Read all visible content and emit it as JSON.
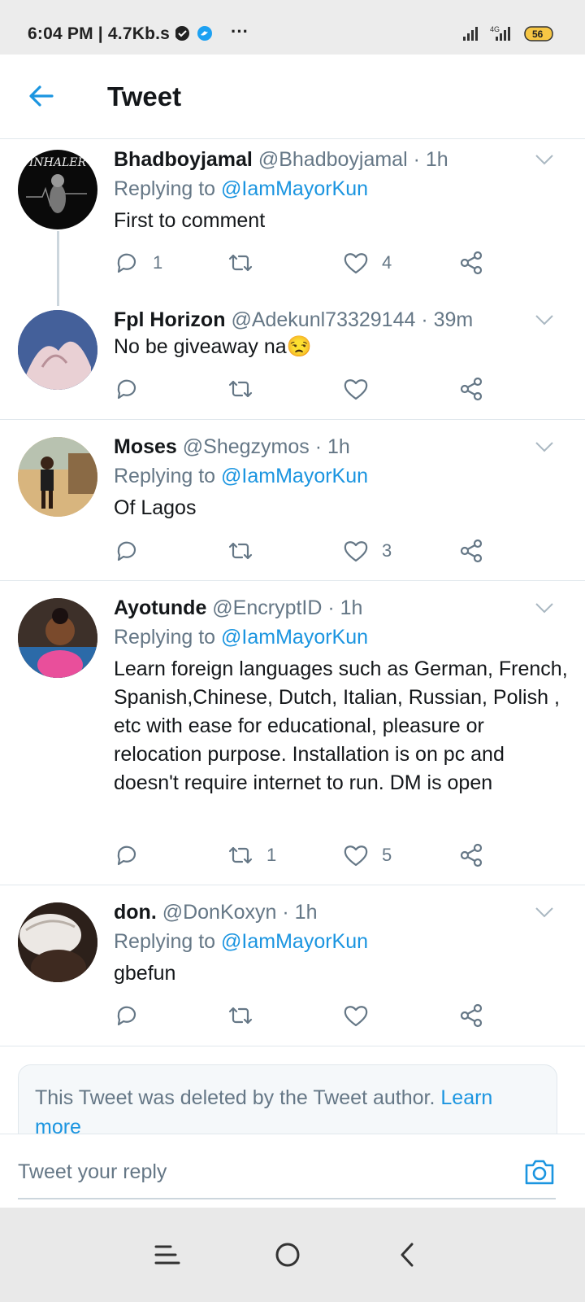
{
  "status_bar": {
    "time_speed": "6:04 PM | 4.7Kb.s",
    "more": "···",
    "network": "4G",
    "battery": "56"
  },
  "header": {
    "title": "Tweet"
  },
  "tweets": [
    {
      "name": "Bhadboyjamal",
      "handle": "@Bhadboyjamal",
      "dot": " · ",
      "age": "1h",
      "replying_prefix": "Replying to ",
      "mention": "@IamMayorKun",
      "text": "First to comment",
      "replies": "1",
      "retweets": "",
      "likes": "4",
      "avatar_text": "INHALER"
    },
    {
      "name": "Fpl Horizon",
      "handle": "@Adekunl73329144",
      "dot": " · ",
      "age": "39m",
      "text": "No be giveaway na😒",
      "replies": "",
      "retweets": "",
      "likes": ""
    },
    {
      "name": "Moses",
      "handle": "@Shegzymos",
      "dot": " · ",
      "age": "1h",
      "replying_prefix": "Replying to ",
      "mention": "@IamMayorKun",
      "text": "Of Lagos",
      "replies": "",
      "retweets": "",
      "likes": "3"
    },
    {
      "name": "Ayotunde",
      "handle": "@EncryptID",
      "dot": " · ",
      "age": "1h",
      "replying_prefix": "Replying to ",
      "mention": "@IamMayorKun",
      "text": "Learn foreign languages such as German, French, Spanish,Chinese, Dutch, Italian, Russian, Polish , etc with ease for educational, pleasure or relocation purpose. Installation is on pc and doesn't require internet to run. DM is open",
      "replies": "",
      "retweets": "1",
      "likes": "5"
    },
    {
      "name": "don.",
      "handle": "@DonKoxyn",
      "dot": " · ",
      "age": "1h",
      "replying_prefix": "Replying to ",
      "mention": "@IamMayorKun",
      "text": "gbefun",
      "replies": "",
      "retweets": "",
      "likes": ""
    }
  ],
  "deleted_notice": {
    "text": "This Tweet was deleted by the Tweet author. ",
    "link": "Learn more"
  },
  "composer": {
    "placeholder": "Tweet your reply"
  },
  "colors": {
    "accent": "#1b95e0",
    "muted": "#657786",
    "text": "#14171a"
  }
}
